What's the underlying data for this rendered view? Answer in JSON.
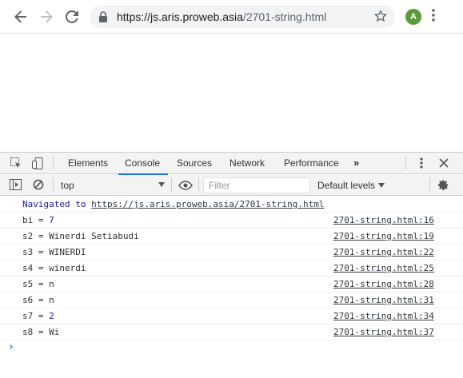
{
  "browser": {
    "url_host": "https://js.aris.proweb.asia",
    "url_path": "/2701-string.html",
    "avatar_letter": "A",
    "icons": [
      "back-arrow-icon",
      "forward-arrow-icon",
      "reload-icon",
      "lock-icon",
      "star-icon",
      "menu-dots-icon"
    ]
  },
  "devtools": {
    "tabs": [
      {
        "label": "Elements"
      },
      {
        "label": "Console",
        "active": true
      },
      {
        "label": "Sources"
      },
      {
        "label": "Network"
      },
      {
        "label": "Performance"
      }
    ],
    "more_tabs": "»",
    "context": "top",
    "filter_placeholder": "Filter",
    "levels": "Default levels",
    "accent": "#1a73e8"
  },
  "console": {
    "navigated_prefix": "Navigated to ",
    "navigated_url": "https://js.aris.proweb.asia/2701-string.html",
    "messages": [
      {
        "label": "bi = ",
        "value": "7",
        "numeric": true,
        "source": "2701-string.html:16"
      },
      {
        "label": "s2 = ",
        "value": "Winerdi Setiabudi",
        "numeric": false,
        "source": "2701-string.html:19"
      },
      {
        "label": "s3 = ",
        "value": "WINERDI",
        "numeric": false,
        "source": "2701-string.html:22"
      },
      {
        "label": "s4 = ",
        "value": "winerdi",
        "numeric": false,
        "source": "2701-string.html:25"
      },
      {
        "label": "s5 = ",
        "value": "n",
        "numeric": false,
        "source": "2701-string.html:28"
      },
      {
        "label": "s6 = ",
        "value": "n",
        "numeric": false,
        "source": "2701-string.html:31"
      },
      {
        "label": "s7 = ",
        "value": "2",
        "numeric": true,
        "source": "2701-string.html:34"
      },
      {
        "label": "s8 = ",
        "value": "Wi",
        "numeric": false,
        "source": "2701-string.html:37"
      }
    ],
    "prompt": "›"
  }
}
